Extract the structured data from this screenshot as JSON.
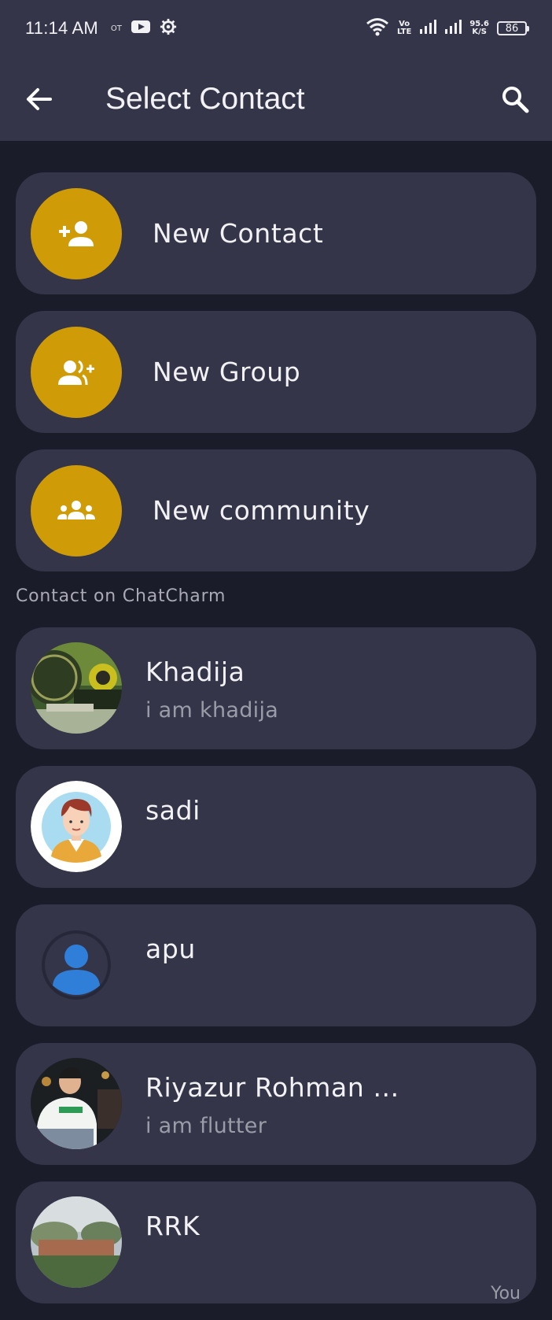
{
  "status_bar": {
    "time": "11:14 AM",
    "ot_label": "OT",
    "net_top": "Vo",
    "net_bottom": "LTE",
    "speed_top": "95.6",
    "speed_bottom": "K/S",
    "battery": "86"
  },
  "app_bar": {
    "title": "Select Contact"
  },
  "actions": [
    {
      "label": "New Contact",
      "icon": "person-add-icon"
    },
    {
      "label": "New Group",
      "icon": "group-add-icon"
    },
    {
      "label": "New community",
      "icon": "community-icon"
    }
  ],
  "section": {
    "label": "Contact on ChatCharm"
  },
  "contacts": [
    {
      "name": "Khadija",
      "status": "i am khadija"
    },
    {
      "name": "sadi",
      "status": ""
    },
    {
      "name": "apu",
      "status": ""
    },
    {
      "name": "Riyazur Rohman ...",
      "status": "i am flutter"
    },
    {
      "name": "RRK",
      "status": "",
      "tag": "You"
    }
  ],
  "colors": {
    "accent": "#cf9b06",
    "card": "#343548",
    "background": "#1b1c29"
  }
}
